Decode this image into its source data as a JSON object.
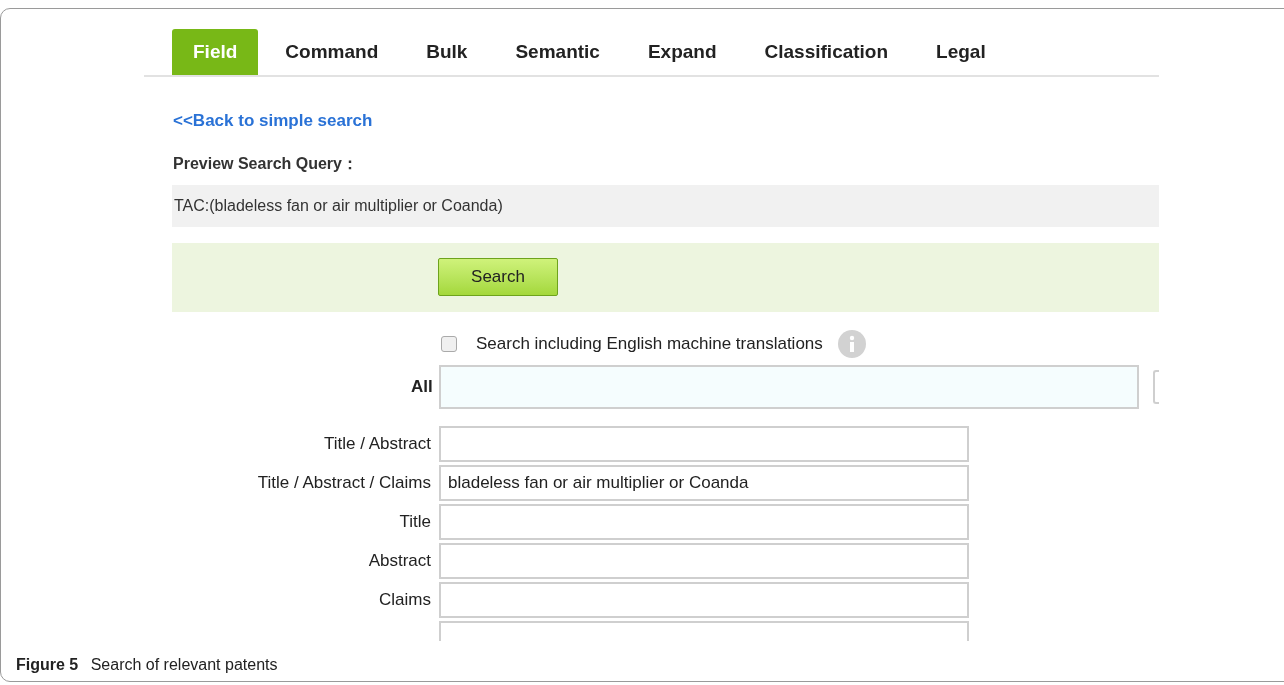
{
  "tabs": [
    {
      "label": "Field",
      "selected": true
    },
    {
      "label": "Command",
      "selected": false
    },
    {
      "label": "Bulk",
      "selected": false
    },
    {
      "label": "Semantic",
      "selected": false
    },
    {
      "label": "Expand",
      "selected": false
    },
    {
      "label": "Classification",
      "selected": false
    },
    {
      "label": "Legal",
      "selected": false
    }
  ],
  "back_link": "<<Back to simple search",
  "preview": {
    "label": "Preview Search Query：",
    "query": "TAC:(bladeless fan or air multiplier or Coanda)"
  },
  "search_button": "Search",
  "machine_translation": {
    "label": "Search including English machine translations",
    "checked": false
  },
  "all_field": {
    "label": "All"
  },
  "fields": [
    {
      "label": "Title / Abstract"
    },
    {
      "label": "Title / Abstract / Claims",
      "value": "bladeless fan or air multiplier or Coanda"
    },
    {
      "label": "Title"
    },
    {
      "label": "Abstract"
    },
    {
      "label": "Claims"
    }
  ],
  "caption": {
    "number": "Figure 5",
    "text": "Search of relevant patents"
  }
}
